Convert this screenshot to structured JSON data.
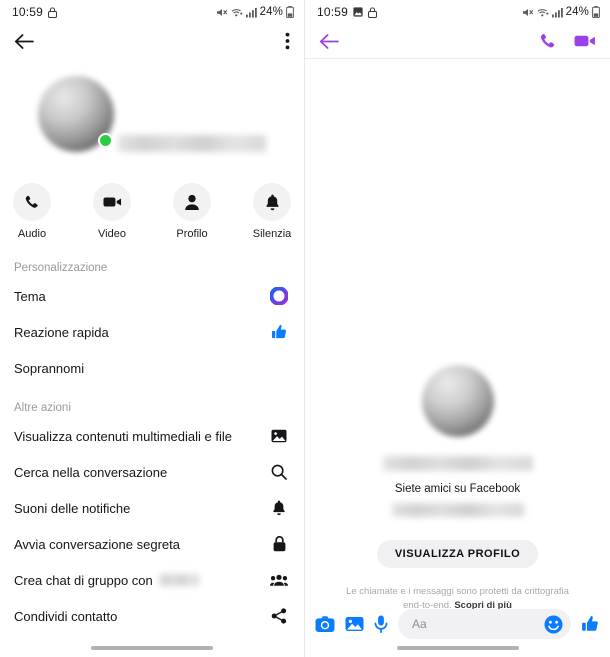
{
  "status_bar": {
    "time": "10:59",
    "battery_pct": "24%",
    "icons": [
      "lock-icon",
      "mute-icon",
      "wifi-icon",
      "signal-icon",
      "battery-icon"
    ],
    "right_icons": [
      "image-icon",
      "lock-icon"
    ]
  },
  "colors": {
    "accent_purple": "#9B3FE8",
    "accent_blue": "#0A7CFF",
    "online_green": "#2ECC40",
    "theme_ring": "#6B2FD6",
    "text_primary": "#16161A",
    "text_muted": "#9A9A9E",
    "surface": "#F1F1F3"
  },
  "left_panel": {
    "nav": {
      "back": "back-arrow-icon",
      "overflow": "more-vertical-icon"
    },
    "profile": {
      "name_redacted": true,
      "presence": "online"
    },
    "actions": [
      {
        "label": "Audio",
        "icon": "phone-icon"
      },
      {
        "label": "Video",
        "icon": "video-camera-icon"
      },
      {
        "label": "Profilo",
        "icon": "person-icon"
      },
      {
        "label": "Silenzia",
        "icon": "bell-icon"
      }
    ],
    "sections": [
      {
        "title": "Personalizzazione",
        "items": [
          {
            "label": "Tema",
            "icon": "theme-ring-icon"
          },
          {
            "label": "Reazione rapida",
            "icon": "thumbs-up-icon"
          },
          {
            "label": "Soprannomi",
            "icon": "none"
          }
        ]
      },
      {
        "title": "Altre azioni",
        "items": [
          {
            "label": "Visualizza contenuti multimediali e file",
            "icon": "image-icon"
          },
          {
            "label": "Cerca nella conversazione",
            "icon": "search-icon"
          },
          {
            "label": "Suoni delle notifiche",
            "icon": "bell-icon"
          },
          {
            "label": "Avvia conversazione segreta",
            "icon": "lock-icon"
          },
          {
            "label": "Crea chat di gruppo con",
            "icon": "group-icon",
            "redacted_suffix": true
          },
          {
            "label": "Condividi contatto",
            "icon": "share-icon"
          }
        ]
      }
    ]
  },
  "right_panel": {
    "nav": {
      "back": "back-arrow-icon",
      "call": "phone-icon",
      "video": "video-camera-icon"
    },
    "intro": {
      "name_redacted": true,
      "subtitle": "Siete amici su Facebook",
      "extra_redacted": true,
      "view_profile_label": "VISUALIZZA PROFILO",
      "encryption_note": "Le chiamate e i messaggi sono protetti da crittografia end-to-end.",
      "encryption_link": "Scopri di più"
    },
    "composer": {
      "placeholder": "Aa",
      "icons": [
        "camera-icon",
        "gallery-icon",
        "microphone-icon",
        "emoji-icon",
        "thumbs-up-icon"
      ]
    }
  }
}
